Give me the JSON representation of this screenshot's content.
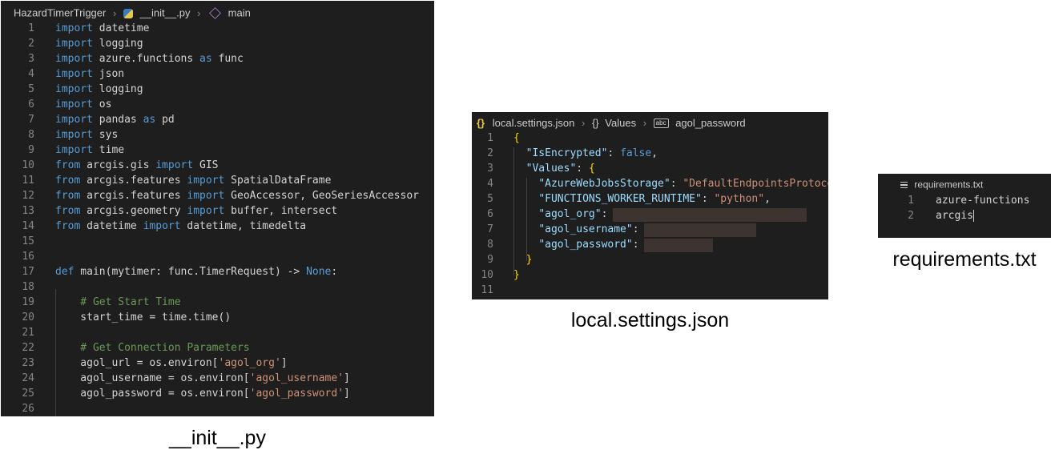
{
  "init_py": {
    "breadcrumb": {
      "folder": "HazardTimerTrigger",
      "file": "__init__.py",
      "symbol": "main"
    },
    "lines": [
      {
        "n": "1",
        "code": "import datetime"
      },
      {
        "n": "2",
        "code": "import logging"
      },
      {
        "n": "3",
        "code": "import azure.functions as func"
      },
      {
        "n": "4",
        "code": "import json"
      },
      {
        "n": "5",
        "code": "import logging"
      },
      {
        "n": "6",
        "code": "import os"
      },
      {
        "n": "7",
        "code": "import pandas as pd"
      },
      {
        "n": "8",
        "code": "import sys"
      },
      {
        "n": "9",
        "code": "import time"
      },
      {
        "n": "10",
        "code": "from arcgis.gis import GIS"
      },
      {
        "n": "11",
        "code": "from arcgis.features import SpatialDataFrame"
      },
      {
        "n": "12",
        "code": "from arcgis.features import GeoAccessor, GeoSeriesAccessor"
      },
      {
        "n": "13",
        "code": "from arcgis.geometry import buffer, intersect"
      },
      {
        "n": "14",
        "code": "from datetime import datetime, timedelta"
      },
      {
        "n": "15",
        "code": ""
      },
      {
        "n": "16",
        "code": ""
      },
      {
        "n": "17",
        "code": "def main(mytimer: func.TimerRequest) -> None:"
      },
      {
        "n": "18",
        "code": ""
      },
      {
        "n": "19",
        "code": "    # Get Start Time"
      },
      {
        "n": "20",
        "code": "    start_time = time.time()"
      },
      {
        "n": "21",
        "code": ""
      },
      {
        "n": "22",
        "code": "    # Get Connection Parameters"
      },
      {
        "n": "23",
        "code": "    agol_url = os.environ['agol_org']"
      },
      {
        "n": "24",
        "code": "    agol_username = os.environ['agol_username']"
      },
      {
        "n": "25",
        "code": "    agol_password = os.environ['agol_password']"
      },
      {
        "n": "26",
        "code": ""
      }
    ],
    "caption": "__init__.py"
  },
  "local_settings": {
    "breadcrumb": {
      "file": "local.settings.json",
      "node": "Values",
      "key": "agol_password"
    },
    "lines": [
      {
        "n": "1",
        "code": "{"
      },
      {
        "n": "2",
        "code": "  \"IsEncrypted\": false,"
      },
      {
        "n": "3",
        "code": "  \"Values\": {"
      },
      {
        "n": "4",
        "code": "    \"AzureWebJobsStorage\": \"DefaultEndpointsProtoco"
      },
      {
        "n": "5",
        "code": "    \"FUNCTIONS_WORKER_RUNTIME\": \"python\","
      },
      {
        "n": "6",
        "code": "    \"agol_org\": "
      },
      {
        "n": "7",
        "code": "    \"agol_username\": "
      },
      {
        "n": "8",
        "code": "    \"agol_password\": "
      },
      {
        "n": "9",
        "code": "  }"
      },
      {
        "n": "10",
        "code": "}"
      },
      {
        "n": "11",
        "code": ""
      }
    ],
    "caption": "local.settings.json"
  },
  "requirements": {
    "breadcrumb": {
      "file": "requirements.txt"
    },
    "lines": [
      {
        "n": "1",
        "code": "azure-functions"
      },
      {
        "n": "2",
        "code": "arcgis"
      }
    ],
    "caption": "requirements.txt"
  }
}
